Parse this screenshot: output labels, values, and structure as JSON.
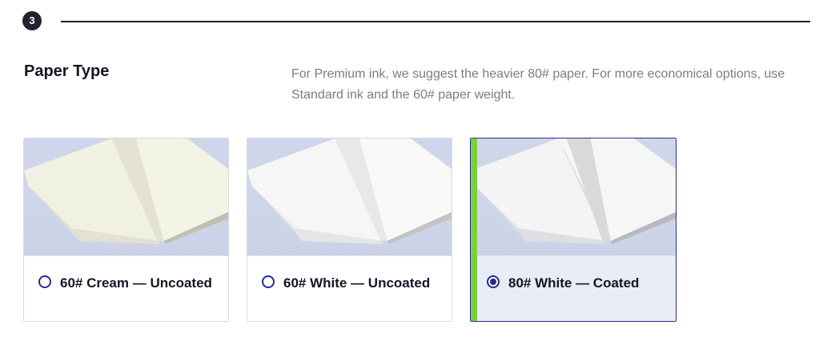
{
  "step": {
    "number": "3"
  },
  "section": {
    "title": "Paper Type",
    "description": "For Premium ink, we suggest the heavier 80# paper. For more economical options, use Standard ink and the 60# paper weight."
  },
  "options": [
    {
      "label": "60# Cream — Uncoated",
      "selected": false,
      "paper_color": "#f2f1e3"
    },
    {
      "label": "60# White — Uncoated",
      "selected": false,
      "paper_color": "#f6f6f4"
    },
    {
      "label": "80# White — Coated",
      "selected": true,
      "paper_color": "#f3f3f3"
    }
  ],
  "colors": {
    "accent": "#262a8c",
    "selected_bar": "#7ccf3a",
    "selected_bg": "#e8ecf7",
    "image_bg": "#cfd6ea"
  }
}
